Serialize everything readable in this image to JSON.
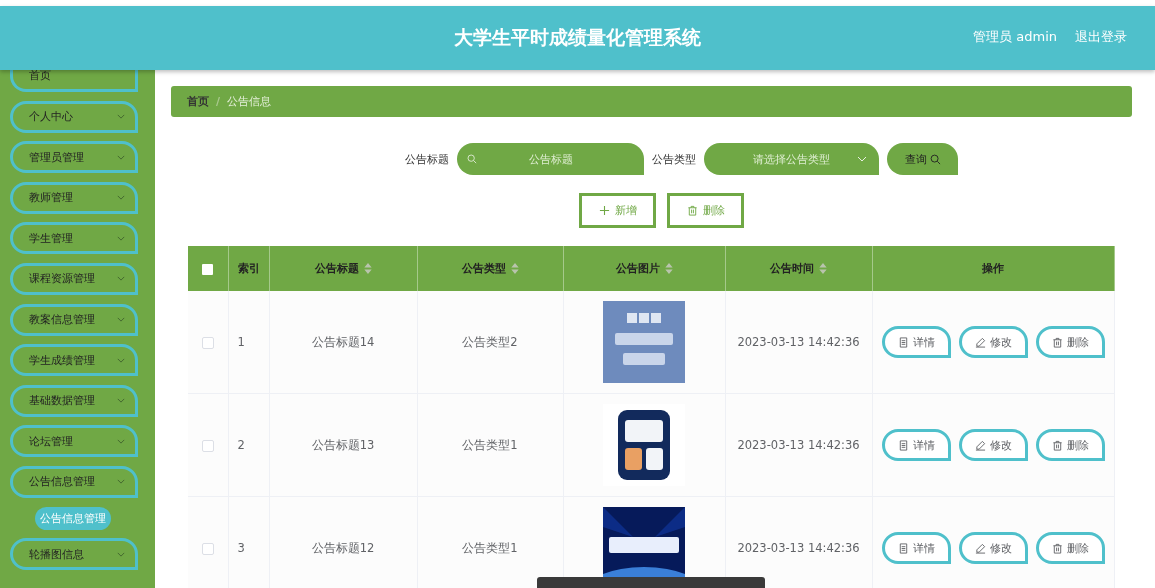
{
  "header": {
    "title": "大学生平时成绩量化管理系统",
    "user": "管理员 admin",
    "logout": "退出登录"
  },
  "sidebar": {
    "items": [
      {
        "label": "首页",
        "kind": "link"
      },
      {
        "label": "个人中心",
        "kind": "menu"
      },
      {
        "label": "管理员管理",
        "kind": "menu"
      },
      {
        "label": "教师管理",
        "kind": "menu"
      },
      {
        "label": "学生管理",
        "kind": "menu"
      },
      {
        "label": "课程资源管理",
        "kind": "menu"
      },
      {
        "label": "教案信息管理",
        "kind": "menu"
      },
      {
        "label": "学生成绩管理",
        "kind": "menu"
      },
      {
        "label": "基础数据管理",
        "kind": "menu"
      },
      {
        "label": "论坛管理",
        "kind": "menu"
      },
      {
        "label": "公告信息管理",
        "kind": "menu",
        "children": [
          {
            "label": "公告信息管理",
            "selected": true
          }
        ]
      },
      {
        "label": "轮播图信息",
        "kind": "menu"
      }
    ]
  },
  "breadcrumb": {
    "separator": "/",
    "items": [
      {
        "label": "首页",
        "current": false
      },
      {
        "label": "公告信息",
        "current": true
      }
    ]
  },
  "search": {
    "fields": [
      {
        "label": "公告标题",
        "placeholder": "公告标题",
        "kind": "text"
      },
      {
        "label": "公告类型",
        "placeholder": "请选择公告类型",
        "kind": "select"
      }
    ],
    "button": "查询"
  },
  "actions": [
    {
      "label": "新增",
      "kind": "add"
    },
    {
      "label": "删除",
      "kind": "delete"
    }
  ],
  "table": {
    "columns": [
      {
        "kind": "checkbox",
        "checked": false
      },
      {
        "kind": "text",
        "label": "索引",
        "sortable": false
      },
      {
        "kind": "text",
        "label": "公告标题",
        "sortable": true
      },
      {
        "kind": "text",
        "label": "公告类型",
        "sortable": true
      },
      {
        "kind": "text",
        "label": "公告图片",
        "sortable": true
      },
      {
        "kind": "text",
        "label": "公告时间",
        "sortable": true
      },
      {
        "kind": "text",
        "label": "操作",
        "sortable": false
      }
    ],
    "rows": [
      {
        "selected": false,
        "index": "1",
        "title": "公告标题14",
        "type": "公告类型2",
        "time": "2023-03-13 14:42:36",
        "actions": [
          {
            "label": "详情",
            "kind": "view"
          },
          {
            "label": "修改",
            "kind": "edit"
          },
          {
            "label": "删除",
            "kind": "delete"
          }
        ]
      },
      {
        "selected": false,
        "index": "2",
        "title": "公告标题13",
        "type": "公告类型1",
        "time": "2023-03-13 14:42:36",
        "actions": [
          {
            "label": "详情",
            "kind": "view"
          },
          {
            "label": "修改",
            "kind": "edit"
          },
          {
            "label": "删除",
            "kind": "delete"
          }
        ]
      },
      {
        "selected": false,
        "index": "3",
        "title": "公告标题12",
        "type": "公告类型1",
        "time": "2023-03-13 14:42:36",
        "actions": [
          {
            "label": "详情",
            "kind": "view"
          },
          {
            "label": "修改",
            "kind": "edit"
          },
          {
            "label": "删除",
            "kind": "delete"
          }
        ]
      }
    ]
  }
}
